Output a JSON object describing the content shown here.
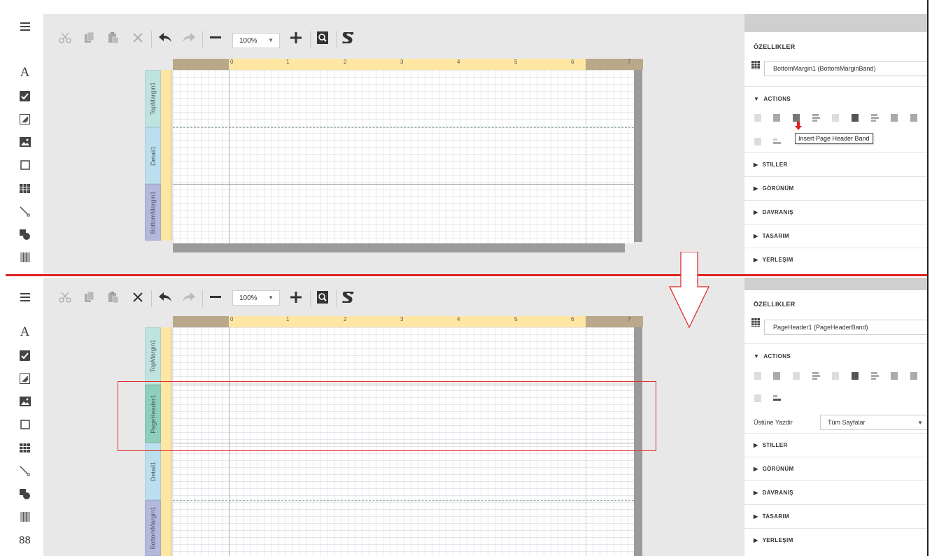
{
  "colors": {
    "ruler": "#ffe7a3",
    "ruler_margin": "#b9a98a",
    "band_topmargin": "#bfe4e0",
    "band_detail": "#bcdff0",
    "band_bottommargin": "#b3b9dd",
    "band_pageheader": "#8dcfba",
    "divider": "#e02020"
  },
  "toolbox": {
    "icons": [
      "menu-icon",
      "text-label-icon",
      "checkbox-icon",
      "rich-text-icon",
      "picture-box-icon",
      "panel-icon",
      "table-icon",
      "line-icon",
      "shape-icon",
      "barcode-icon"
    ],
    "extra_label": "88"
  },
  "toolbar": {
    "zoom": "100%",
    "buttons": [
      "cut-icon",
      "copy-icon",
      "paste-icon",
      "delete-icon",
      "undo-icon",
      "redo-icon",
      "zoom-out-icon",
      "zoom-in-icon",
      "preview-icon",
      "script-icon"
    ]
  },
  "ruler": {
    "labels": [
      "0",
      "1",
      "2",
      "3",
      "4",
      "5",
      "6",
      "7"
    ]
  },
  "top": {
    "bands": [
      "TopMargin1",
      "Detail1",
      "BottomMargin1"
    ],
    "properties": {
      "title": "ÖZELLIKLER",
      "selected": "BottomMargin1 (BottomMarginBand)",
      "actions_label": "ACTIONS",
      "tooltip": "Insert Page Header Band",
      "sections": [
        "STILLER",
        "GÖRÜNÜM",
        "DAVRANIŞ",
        "TASARIM",
        "YERLEŞIM"
      ]
    }
  },
  "bottom": {
    "bands": [
      "TopMargin1",
      "PageHeader1",
      "Detail1",
      "BottomMargin1"
    ],
    "properties": {
      "title": "ÖZELLIKLER",
      "selected": "PageHeader1 (PageHeaderBand)",
      "actions_label": "ACTIONS",
      "print_on_label": "Üstüne Yazdir",
      "print_on_value": "Tüm Sayfalar",
      "sections": [
        "STILLER",
        "GÖRÜNÜM",
        "DAVRANIŞ",
        "TASARIM",
        "YERLEŞIM"
      ]
    }
  }
}
